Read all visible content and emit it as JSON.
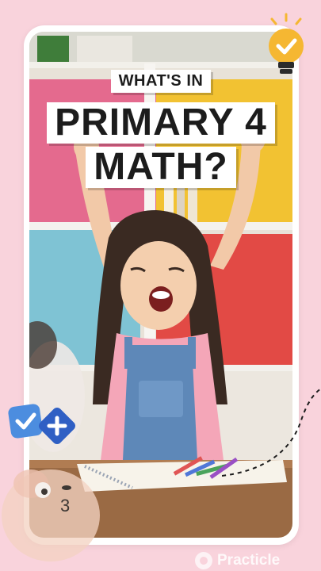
{
  "headline": {
    "line1": "WHAT'S IN",
    "line2": "PRIMARY 4",
    "line3": "MATH?"
  },
  "brand": {
    "name": "Practicle"
  },
  "icons": [
    "lightbulb-check-icon",
    "checkmark-badge-icon",
    "plus-badge-icon",
    "mascot-icon",
    "practicle-logo-icon"
  ],
  "colors": {
    "background": "#f9d3dc",
    "card": "#ffffff",
    "bulb": "#f5b732",
    "badge_blue": "#4c8ddf",
    "badge_navy": "#2f5fc4"
  }
}
